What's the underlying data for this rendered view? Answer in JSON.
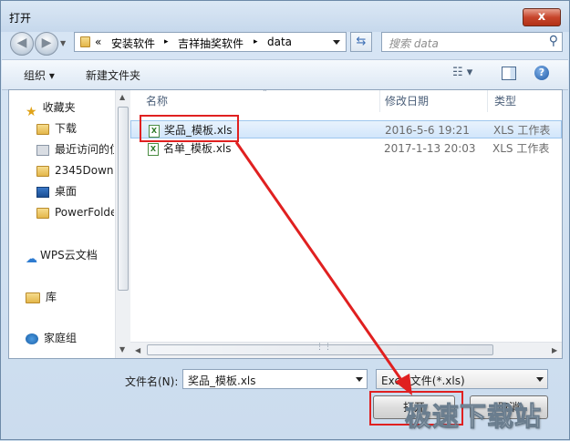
{
  "window": {
    "title": "打开",
    "close_label": "x"
  },
  "address": {
    "chevron": "«",
    "path": [
      "安装软件",
      "吉祥抽奖软件",
      "data"
    ],
    "sep": "▸"
  },
  "search": {
    "placeholder": "搜索 data"
  },
  "toolbar": {
    "organize": "组织 ▾",
    "new_folder": "新建文件夹"
  },
  "nav": {
    "items": [
      {
        "label": "收藏夹",
        "icon": "star-icon"
      },
      {
        "label": "下载",
        "icon": "download-folder-icon"
      },
      {
        "label": "最近访问的位",
        "icon": "recent-places-icon"
      },
      {
        "label": "2345Downl",
        "icon": "folder-icon"
      },
      {
        "label": "桌面",
        "icon": "desktop-icon"
      },
      {
        "label": "PowerFolde",
        "icon": "folder-icon"
      },
      {
        "label": "WPS云文档",
        "icon": "cloud-icon"
      },
      {
        "label": "库",
        "icon": "library-icon"
      },
      {
        "label": "家庭组",
        "icon": "homegroup-icon"
      }
    ]
  },
  "files": {
    "columns": [
      "名称",
      "修改日期",
      "类型"
    ],
    "rows": [
      {
        "name": "奖品_模板.xls",
        "date": "2016-5-6 19:21",
        "type": "XLS 工作表",
        "selected": true
      },
      {
        "name": "名单_模板.xls",
        "date": "2017-1-13 20:03",
        "type": "XLS 工作表",
        "selected": false
      }
    ]
  },
  "filename": {
    "label": "文件名(N):",
    "value": "奖品_模板.xls"
  },
  "filetype": {
    "value": "Excel文件(*.xls)"
  },
  "buttons": {
    "open": "打开",
    "cancel": "取消"
  },
  "watermark": "极速下载站",
  "colors": {
    "highlight": "#e02020",
    "selection": "#d2e6fb"
  }
}
